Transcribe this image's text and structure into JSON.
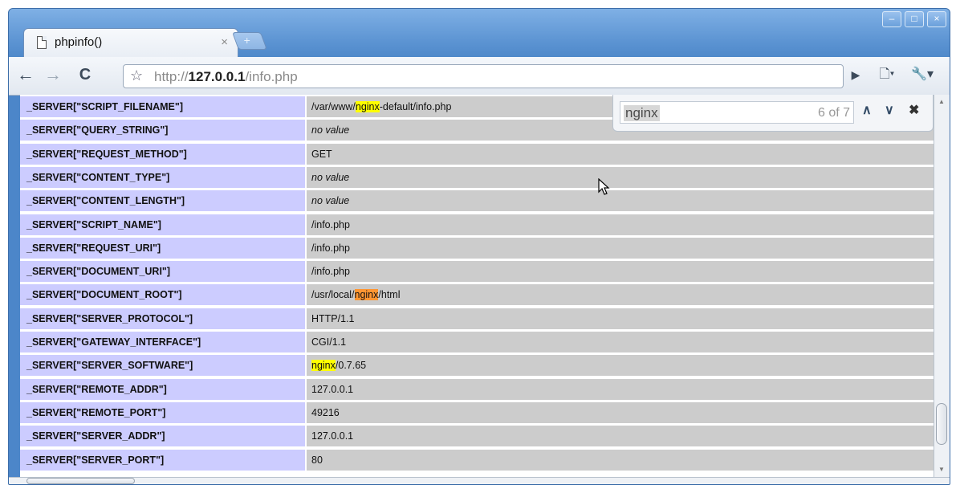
{
  "tab": {
    "title": "phpinfo()",
    "close": "×",
    "new_tab": "+"
  },
  "window_controls": {
    "minimize": "–",
    "maximize": "□",
    "close": "×"
  },
  "nav": {
    "back": "←",
    "forward": "→",
    "reload": "C"
  },
  "omnibox": {
    "star": "☆",
    "url_scheme": "http://",
    "url_host": "127.0.0.1",
    "url_path": "/info.php"
  },
  "toolbar": {
    "go": "▶",
    "page_menu": "🗋▾",
    "wrench_menu": "🔧▾"
  },
  "find": {
    "query": "nginx",
    "count": "6 of 7",
    "prev": "∧",
    "next": "∨",
    "close": "✖"
  },
  "rows": [
    {
      "key": "_SERVER[\"SCRIPT_FILENAME\"]",
      "pre": "/var/www/",
      "match": "nginx",
      "match_color": "yellow",
      "post": "-default/info.php"
    },
    {
      "key": "_SERVER[\"QUERY_STRING\"]",
      "value": "no value",
      "no_value": true
    },
    {
      "key": "_SERVER[\"REQUEST_METHOD\"]",
      "value": "GET"
    },
    {
      "key": "_SERVER[\"CONTENT_TYPE\"]",
      "value": "no value",
      "no_value": true
    },
    {
      "key": "_SERVER[\"CONTENT_LENGTH\"]",
      "value": "no value",
      "no_value": true
    },
    {
      "key": "_SERVER[\"SCRIPT_NAME\"]",
      "value": "/info.php"
    },
    {
      "key": "_SERVER[\"REQUEST_URI\"]",
      "value": "/info.php"
    },
    {
      "key": "_SERVER[\"DOCUMENT_URI\"]",
      "value": "/info.php"
    },
    {
      "key": "_SERVER[\"DOCUMENT_ROOT\"]",
      "pre": "/usr/local/",
      "match": "nginx",
      "match_color": "orange",
      "post": "/html"
    },
    {
      "key": "_SERVER[\"SERVER_PROTOCOL\"]",
      "value": "HTTP/1.1"
    },
    {
      "key": "_SERVER[\"GATEWAY_INTERFACE\"]",
      "value": "CGI/1.1"
    },
    {
      "key": "_SERVER[\"SERVER_SOFTWARE\"]",
      "pre": "",
      "match": "nginx",
      "match_color": "yellow",
      "post": "/0.7.65"
    },
    {
      "key": "_SERVER[\"REMOTE_ADDR\"]",
      "value": "127.0.0.1"
    },
    {
      "key": "_SERVER[\"REMOTE_PORT\"]",
      "value": "49216"
    },
    {
      "key": "_SERVER[\"SERVER_ADDR\"]",
      "value": "127.0.0.1"
    },
    {
      "key": "_SERVER[\"SERVER_PORT\"]",
      "value": "80"
    }
  ]
}
